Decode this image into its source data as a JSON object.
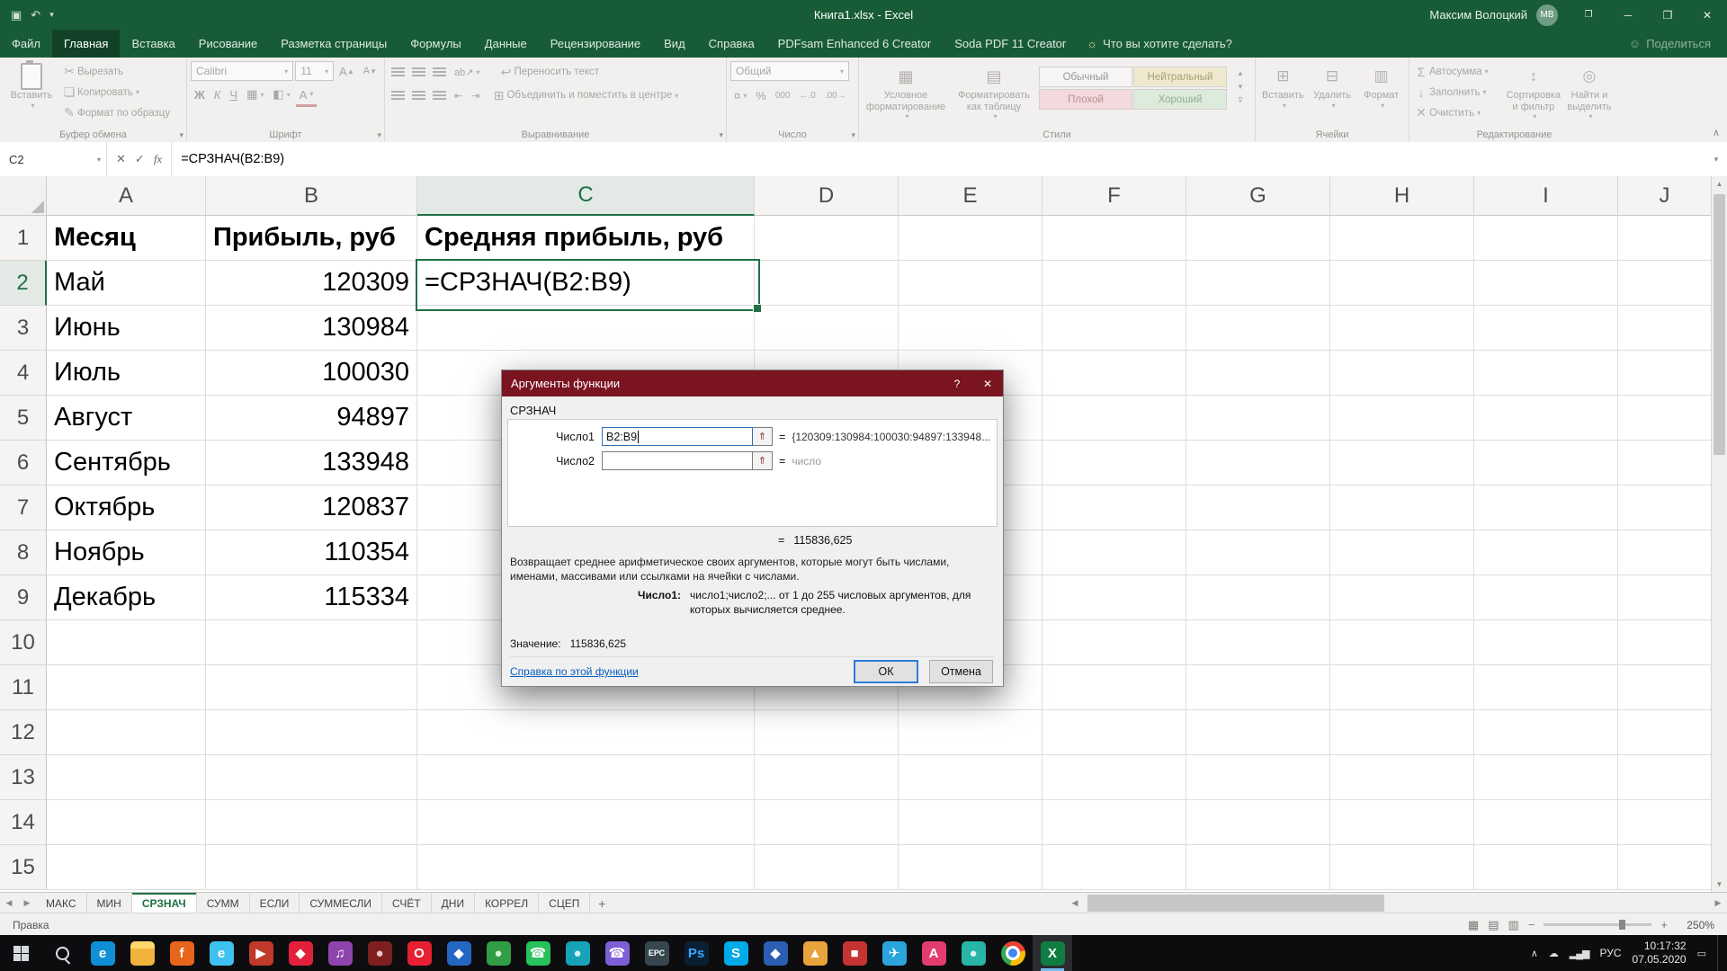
{
  "window": {
    "title": "Книга1.xlsx - Excel",
    "user_name": "Максим Волоцкий",
    "avatar_initials": "МВ"
  },
  "icons": {
    "caret_down": "▾",
    "qat_save": "▣",
    "qat_undo": "↶",
    "bulb": "☼",
    "person": "☺",
    "minimize": "─",
    "restore": "❐",
    "close": "✕",
    "cut": "✂",
    "copy": "❏",
    "painter": "✎",
    "borders": "▦",
    "fill_color": "◧",
    "font_color": "А",
    "orientation": "ab↗",
    "wrap": "↩",
    "merge": "⊞",
    "currency": "¤",
    "percent": "%",
    "thousands": "000",
    "dec_inc": "←.0",
    "dec_dec": ".00→",
    "autosum": "Σ",
    "fill_down": "↓",
    "clear": "✕",
    "sort": "↕",
    "find": "◎",
    "cancel_entry": "✕",
    "enter_entry": "✓",
    "fx": "fx",
    "range_picker": "⇑",
    "help": "?",
    "view_normal": "▦",
    "view_layout": "▤",
    "view_break": "▥",
    "zoom_minus": "−",
    "zoom_plus": "+",
    "tray_chevron": "∧",
    "tray_cloud": "☁",
    "tray_signal": "▂▄▆",
    "tray_notif": "▭",
    "sheet_prev": "◀",
    "sheet_next": "▶",
    "scroll_up": "▲",
    "scroll_down": "▼",
    "scroll_left": "◀",
    "scroll_right": "▶",
    "add_sheet": "+",
    "collapse_ribbon": "∧"
  },
  "ribbon_tabs": {
    "items": [
      "Файл",
      "Главная",
      "Вставка",
      "Рисование",
      "Разметка страницы",
      "Формулы",
      "Данные",
      "Рецензирование",
      "Вид",
      "Справка",
      "PDFsam Enhanced 6 Creator",
      "Soda PDF 11 Creator"
    ],
    "active": "Главная",
    "search_placeholder": "Что вы хотите сделать?",
    "share_label": "Поделиться"
  },
  "ribbon": {
    "clipboard": {
      "group": "Буфер обмена",
      "paste": "Вставить",
      "cut": "Вырезать",
      "copy": "Копировать",
      "painter": "Формат по образцу"
    },
    "font": {
      "group": "Шрифт",
      "name": "Calibri",
      "size": "11",
      "bold": "Ж",
      "italic": "К",
      "underline": "Ч"
    },
    "alignment": {
      "group": "Выравнивание",
      "wrap": "Переносить текст",
      "merge": "Объединить и поместить в центре"
    },
    "number": {
      "group": "Число",
      "format": "Общий"
    },
    "styles": {
      "group": "Стили",
      "conditional": "Условное форматирование",
      "as_table": "Форматировать как таблицу",
      "gallery": [
        {
          "label": "Обычный",
          "bg": "#f6f5f4",
          "fg": "#9a9896"
        },
        {
          "label": "Нейтральный",
          "bg": "#efe9cf",
          "fg": "#a89f74"
        },
        {
          "label": "Плохой",
          "bg": "#f3dadd",
          "fg": "#b98f95"
        },
        {
          "label": "Хороший",
          "bg": "#dcebdc",
          "fg": "#8fae90"
        }
      ]
    },
    "cells": {
      "group": "Ячейки",
      "insert": "Вставить",
      "delete": "Удалить",
      "format": "Формат"
    },
    "editing": {
      "group": "Редактирование",
      "autosum": "Автосумма",
      "fill": "Заполнить",
      "clear": "Очистить",
      "sort": "Сортировка и фильтр",
      "find": "Найти и выделить"
    }
  },
  "formula_bar": {
    "name_box": "C2",
    "formula": "=СРЗНАЧ(B2:B9)"
  },
  "grid": {
    "columns": [
      "A",
      "B",
      "C",
      "D",
      "E",
      "F",
      "G",
      "H",
      "I",
      "J"
    ],
    "selected_column": "C",
    "selected_row": "2",
    "rows": [
      {
        "n": "1",
        "A": "Месяц",
        "B": "Прибыль, руб",
        "C": "Средняя прибыль, руб",
        "bold": true
      },
      {
        "n": "2",
        "A": "Май",
        "B": "120309",
        "C": "=СРЗНАЧ(B2:B9)"
      },
      {
        "n": "3",
        "A": "Июнь",
        "B": "130984"
      },
      {
        "n": "4",
        "A": "Июль",
        "B": "100030"
      },
      {
        "n": "5",
        "A": "Август",
        "B": "94897"
      },
      {
        "n": "6",
        "A": "Сентябрь",
        "B": "133948"
      },
      {
        "n": "7",
        "A": "Октябрь",
        "B": "120837"
      },
      {
        "n": "8",
        "A": "Ноябрь",
        "B": "110354"
      },
      {
        "n": "9",
        "A": "Декабрь",
        "B": "115334"
      },
      {
        "n": "10"
      },
      {
        "n": "11"
      },
      {
        "n": "12"
      },
      {
        "n": "13"
      },
      {
        "n": "14"
      },
      {
        "n": "15"
      }
    ]
  },
  "dialog": {
    "title": "Аргументы функции",
    "function_name": "СРЗНАЧ",
    "arg1_label": "Число1",
    "arg1_value": "B2:B9",
    "arg1_result": "{120309:130984:100030:94897:133948...",
    "arg2_label": "Число2",
    "arg2_value": "",
    "arg2_result": "число",
    "equals": "=",
    "result": "115836,625",
    "description": "Возвращает среднее арифметическое своих аргументов, которые могут быть числами, именами, массивами или ссылками на ячейки с числами.",
    "hint_label": "Число1:",
    "hint_text": "число1;число2;... от 1 до 255 числовых аргументов, для которых вычисляется среднее.",
    "value_label": "Значение:",
    "value": "115836,625",
    "help_link": "Справка по этой функции",
    "ok": "ОК",
    "cancel": "Отмена"
  },
  "sheet_bar": {
    "tabs": [
      "МАКС",
      "МИН",
      "СРЗНАЧ",
      "СУММ",
      "ЕСЛИ",
      "СУММЕСЛИ",
      "СЧЁТ",
      "ДНИ",
      "КОРРЕЛ",
      "СЦЕП"
    ],
    "active": "СРЗНАЧ"
  },
  "status_bar": {
    "mode": "Правка",
    "zoom": "250%"
  },
  "taskbar": {
    "apps": [
      {
        "name": "edge",
        "glyph": "e",
        "bg": "#0f8fd5",
        "fg": "#ffffff"
      },
      {
        "name": "file-explorer",
        "glyph": "",
        "bg": "folder",
        "fg": "#8a6d1f"
      },
      {
        "name": "firefox",
        "glyph": "f",
        "bg": "#e8651c",
        "fg": "#ffffff"
      },
      {
        "name": "ie",
        "glyph": "e",
        "bg": "#3fc1f0",
        "fg": "#ffffff"
      },
      {
        "name": "media-player",
        "glyph": "▶",
        "bg": "#c0392b",
        "fg": "#ffffff"
      },
      {
        "name": "opera-gx",
        "glyph": "◆",
        "bg": "#e2203c",
        "fg": "#ffffff"
      },
      {
        "name": "music-app",
        "glyph": "♫",
        "bg": "#8e44ad",
        "fg": "#ffffff"
      },
      {
        "name": "app-darkred",
        "glyph": "●",
        "bg": "#7e1f1f",
        "fg": "#e8c8c8"
      },
      {
        "name": "opera",
        "glyph": "O",
        "bg": "#e61f32",
        "fg": "#ffffff"
      },
      {
        "name": "app-blue",
        "glyph": "◆",
        "bg": "#2467c2",
        "fg": "#ffffff"
      },
      {
        "name": "app-green",
        "glyph": "●",
        "bg": "#2f9e44",
        "fg": "#d8f2dc"
      },
      {
        "name": "whatsapp",
        "glyph": "☎",
        "bg": "#27c25a",
        "fg": "#ffffff"
      },
      {
        "name": "app-teal",
        "glyph": "●",
        "bg": "#17a2b8",
        "fg": "#d2eef2"
      },
      {
        "name": "viber",
        "glyph": "☎",
        "bg": "#7d5fd8",
        "fg": "#ffffff"
      },
      {
        "name": "epc",
        "glyph": "ЕРС",
        "bg": "#37474f",
        "fg": "#ffffff"
      },
      {
        "name": "photoshop",
        "glyph": "Ps",
        "bg": "#0b1f33",
        "fg": "#39a6ff"
      },
      {
        "name": "skype",
        "glyph": "S",
        "bg": "#00a9e8",
        "fg": "#ffffff"
      },
      {
        "name": "app-navy",
        "glyph": "◆",
        "bg": "#2c5fb3",
        "fg": "#ffffff"
      },
      {
        "name": "app-amber",
        "glyph": "▲",
        "bg": "#e8a33d",
        "fg": "#ffffff"
      },
      {
        "name": "app-red",
        "glyph": "■",
        "bg": "#c63333",
        "fg": "#ffffff"
      },
      {
        "name": "telegram",
        "glyph": "✈",
        "bg": "#2aa5dc",
        "fg": "#ffffff"
      },
      {
        "name": "app-pink",
        "glyph": "A",
        "bg": "#e23d6e",
        "fg": "#ffffff"
      },
      {
        "name": "app-cyan",
        "glyph": "●",
        "bg": "#28b5a5",
        "fg": "#d8f2ee"
      },
      {
        "name": "chrome",
        "glyph": "",
        "bg": "chrome",
        "fg": "#ffffff"
      },
      {
        "name": "excel",
        "glyph": "X",
        "bg": "#107c41",
        "fg": "#ffffff",
        "active": true
      }
    ],
    "tray": {
      "lang": "РУС",
      "time": "10:17:32",
      "date": "07.05.2020"
    }
  }
}
